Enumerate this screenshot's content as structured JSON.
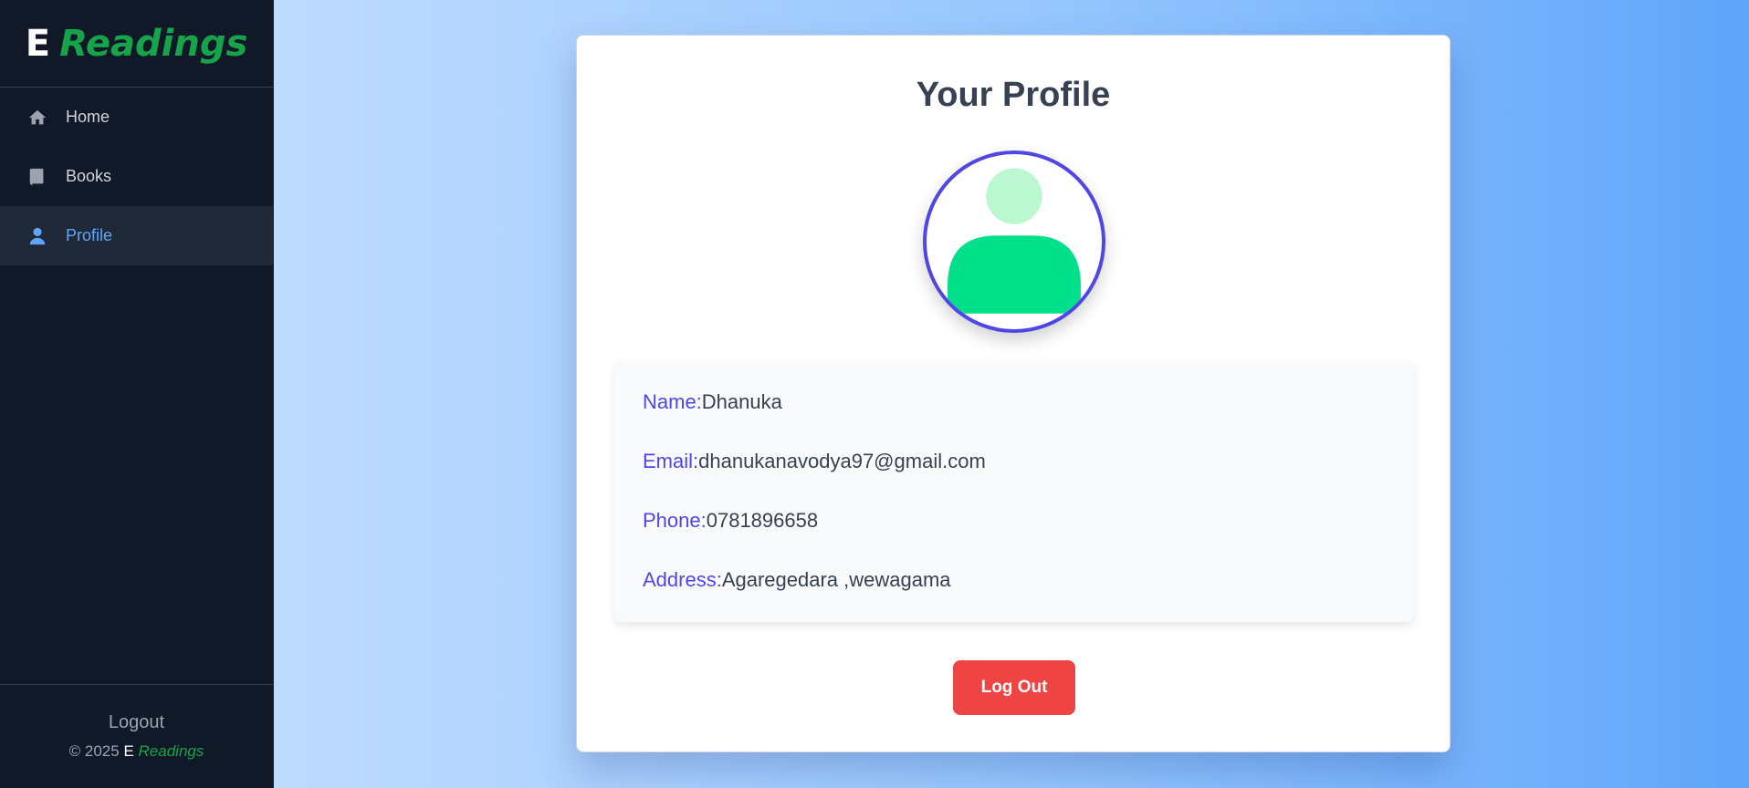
{
  "brand": {
    "e": "E",
    "name": "Readings"
  },
  "nav": {
    "items": [
      {
        "label": "Home",
        "icon": "home-icon"
      },
      {
        "label": "Books",
        "icon": "book-icon"
      },
      {
        "label": "Profile",
        "icon": "user-icon",
        "active": true
      }
    ]
  },
  "sidebar_footer": {
    "logout": "Logout",
    "copyright_prefix": "© 2025",
    "copyright_e": "E",
    "copyright_name": "Readings"
  },
  "profile": {
    "title": "Your Profile",
    "avatar_icon": "user-avatar-icon",
    "fields": [
      {
        "label": "Name:",
        "value": "Dhanuka"
      },
      {
        "label": "Email:",
        "value": "dhanukanavodya97@gmail.com"
      },
      {
        "label": "Phone:",
        "value": "0781896658"
      },
      {
        "label": "Address:",
        "value": "Agaregedara ,wewagama"
      }
    ],
    "logout_button": "Log Out"
  },
  "colors": {
    "sidebar_bg": "#111827",
    "brand_green": "#16a34a",
    "active_blue": "#60a5fa",
    "label_indigo": "#4f46e5",
    "avatar_green": "#00e08a",
    "avatar_head": "#bbf7d0",
    "logout_red": "#ef4444"
  }
}
